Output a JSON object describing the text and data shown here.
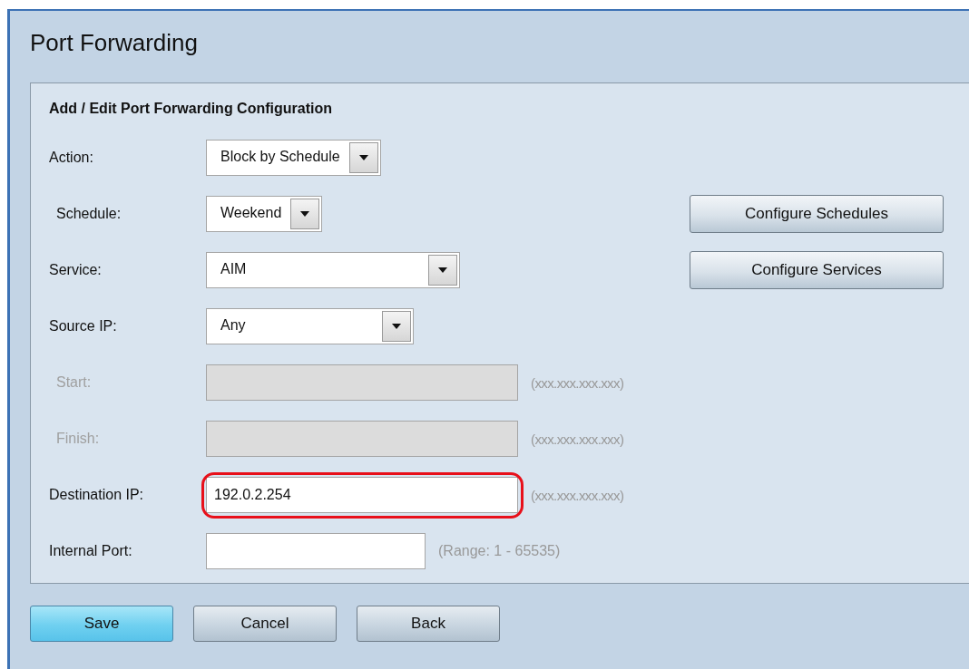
{
  "page": {
    "title": "Port Forwarding"
  },
  "form": {
    "heading": "Add / Edit Port Forwarding Configuration",
    "rows": [
      {
        "label": "Action:",
        "kind": "select",
        "value": "Block by Schedule",
        "disabled": false
      },
      {
        "label": "Schedule:",
        "kind": "select",
        "value": "Weekend",
        "disabled": false,
        "side_button": "Configure Schedules"
      },
      {
        "label": "Service:",
        "kind": "select",
        "value": "AIM",
        "disabled": false,
        "side_button": "Configure Services"
      },
      {
        "label": "Source IP:",
        "kind": "select",
        "value": "Any",
        "disabled": false
      },
      {
        "label": "Start:",
        "kind": "text",
        "disabled": true,
        "hint": "(xxx.xxx.xxx.xxx)"
      },
      {
        "label": "Finish:",
        "kind": "text",
        "disabled": true,
        "hint": "(xxx.xxx.xxx.xxx)"
      },
      {
        "label": "Destination IP:",
        "kind": "text",
        "value": "192.0.2.254",
        "disabled": false,
        "highlighted": true,
        "hint": "(xxx.xxx.xxx.xxx)"
      },
      {
        "label": "Internal Port:",
        "kind": "text",
        "disabled": false,
        "hint": "(Range: 1 - 65535)"
      }
    ]
  },
  "buttons": [
    {
      "label": "Save",
      "primary": true
    },
    {
      "label": "Cancel",
      "primary": false
    },
    {
      "label": "Back",
      "primary": false
    }
  ]
}
